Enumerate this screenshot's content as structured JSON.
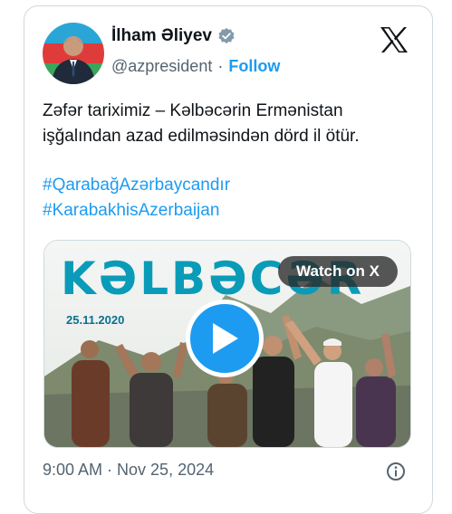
{
  "tweet": {
    "author_name": "İlham Əliyev",
    "handle": "@azpresident",
    "separator": "·",
    "follow_label": "Follow",
    "text": "Zəfər tariximiz – Kəlbəcərin Ermənistan işğalından azad edilməsindən dörd il ötür.",
    "hashtags": [
      "#QarabağAzərbaycandır",
      "#KarabakhisAzerbaijan"
    ],
    "timestamp": "9:00 AM · Nov 25, 2024"
  },
  "media": {
    "title": "KƏLBƏCƏR",
    "date": "25.11.2020",
    "watch_label": "Watch on X"
  },
  "icons": {
    "verified": "verified-badge-icon",
    "x_logo": "x-logo-icon",
    "play": "play-icon",
    "info": "info-icon"
  },
  "colors": {
    "accent": "#1d9bf0",
    "text": "#0f1419",
    "secondary": "#536471",
    "border": "#cfd9de",
    "media_title": "#0a9bb8"
  }
}
